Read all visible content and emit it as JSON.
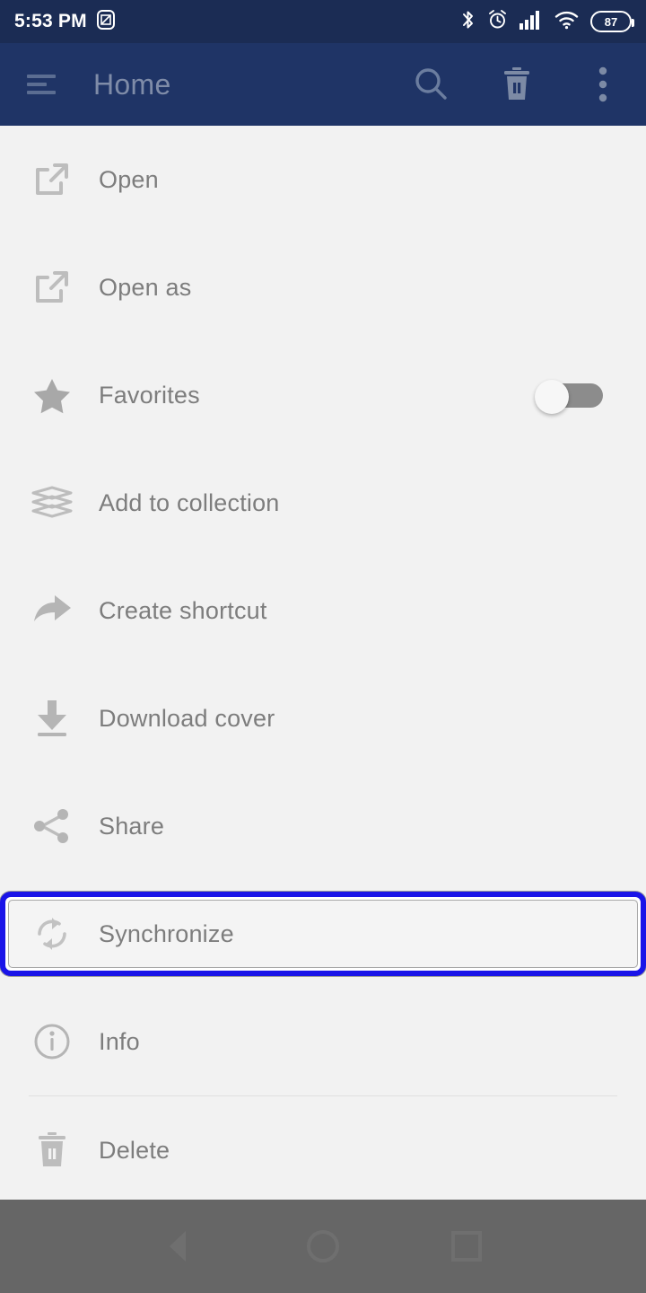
{
  "status_bar": {
    "time": "5:53 PM",
    "icons": [
      "dnd-square-icon",
      "bluetooth-icon",
      "alarm-icon",
      "signal-icon",
      "wifi-icon"
    ],
    "battery_level": "87",
    "background_color": "#1b2c54"
  },
  "app_bar": {
    "menu_icon": "hamburger-menu-icon",
    "title": "Home",
    "search_icon": "search-icon",
    "trash_icon": "trash-icon",
    "overflow_icon": "overflow-menu-icon",
    "background_color": "#1f3466",
    "title_color": "#7f8ca8"
  },
  "menu": {
    "items": [
      {
        "label": "Open",
        "icon": "external-link-icon"
      },
      {
        "label": "Open as",
        "icon": "external-link-icon"
      },
      {
        "label": "Favorites",
        "icon": "star-icon",
        "toggle": "off"
      },
      {
        "label": "Add to collection",
        "icon": "stacked-layers-icon"
      },
      {
        "label": "Create shortcut",
        "icon": "forward-arrow-icon"
      },
      {
        "label": "Download cover",
        "icon": "download-icon"
      },
      {
        "label": "Share",
        "icon": "share-icon"
      },
      {
        "label": "Synchronize",
        "icon": "sync-icon",
        "selected": true
      },
      {
        "label": "Info",
        "icon": "info-icon"
      },
      {
        "label": "Delete",
        "icon": "trash-icon"
      }
    ],
    "label_color": "#7d7d7d",
    "background_color": "#f2f2f2",
    "selection_color": "#1a14e8"
  },
  "nav_bar": {
    "buttons": [
      "back-button",
      "home-button",
      "recents-button"
    ],
    "scrim_color": "#666666"
  }
}
